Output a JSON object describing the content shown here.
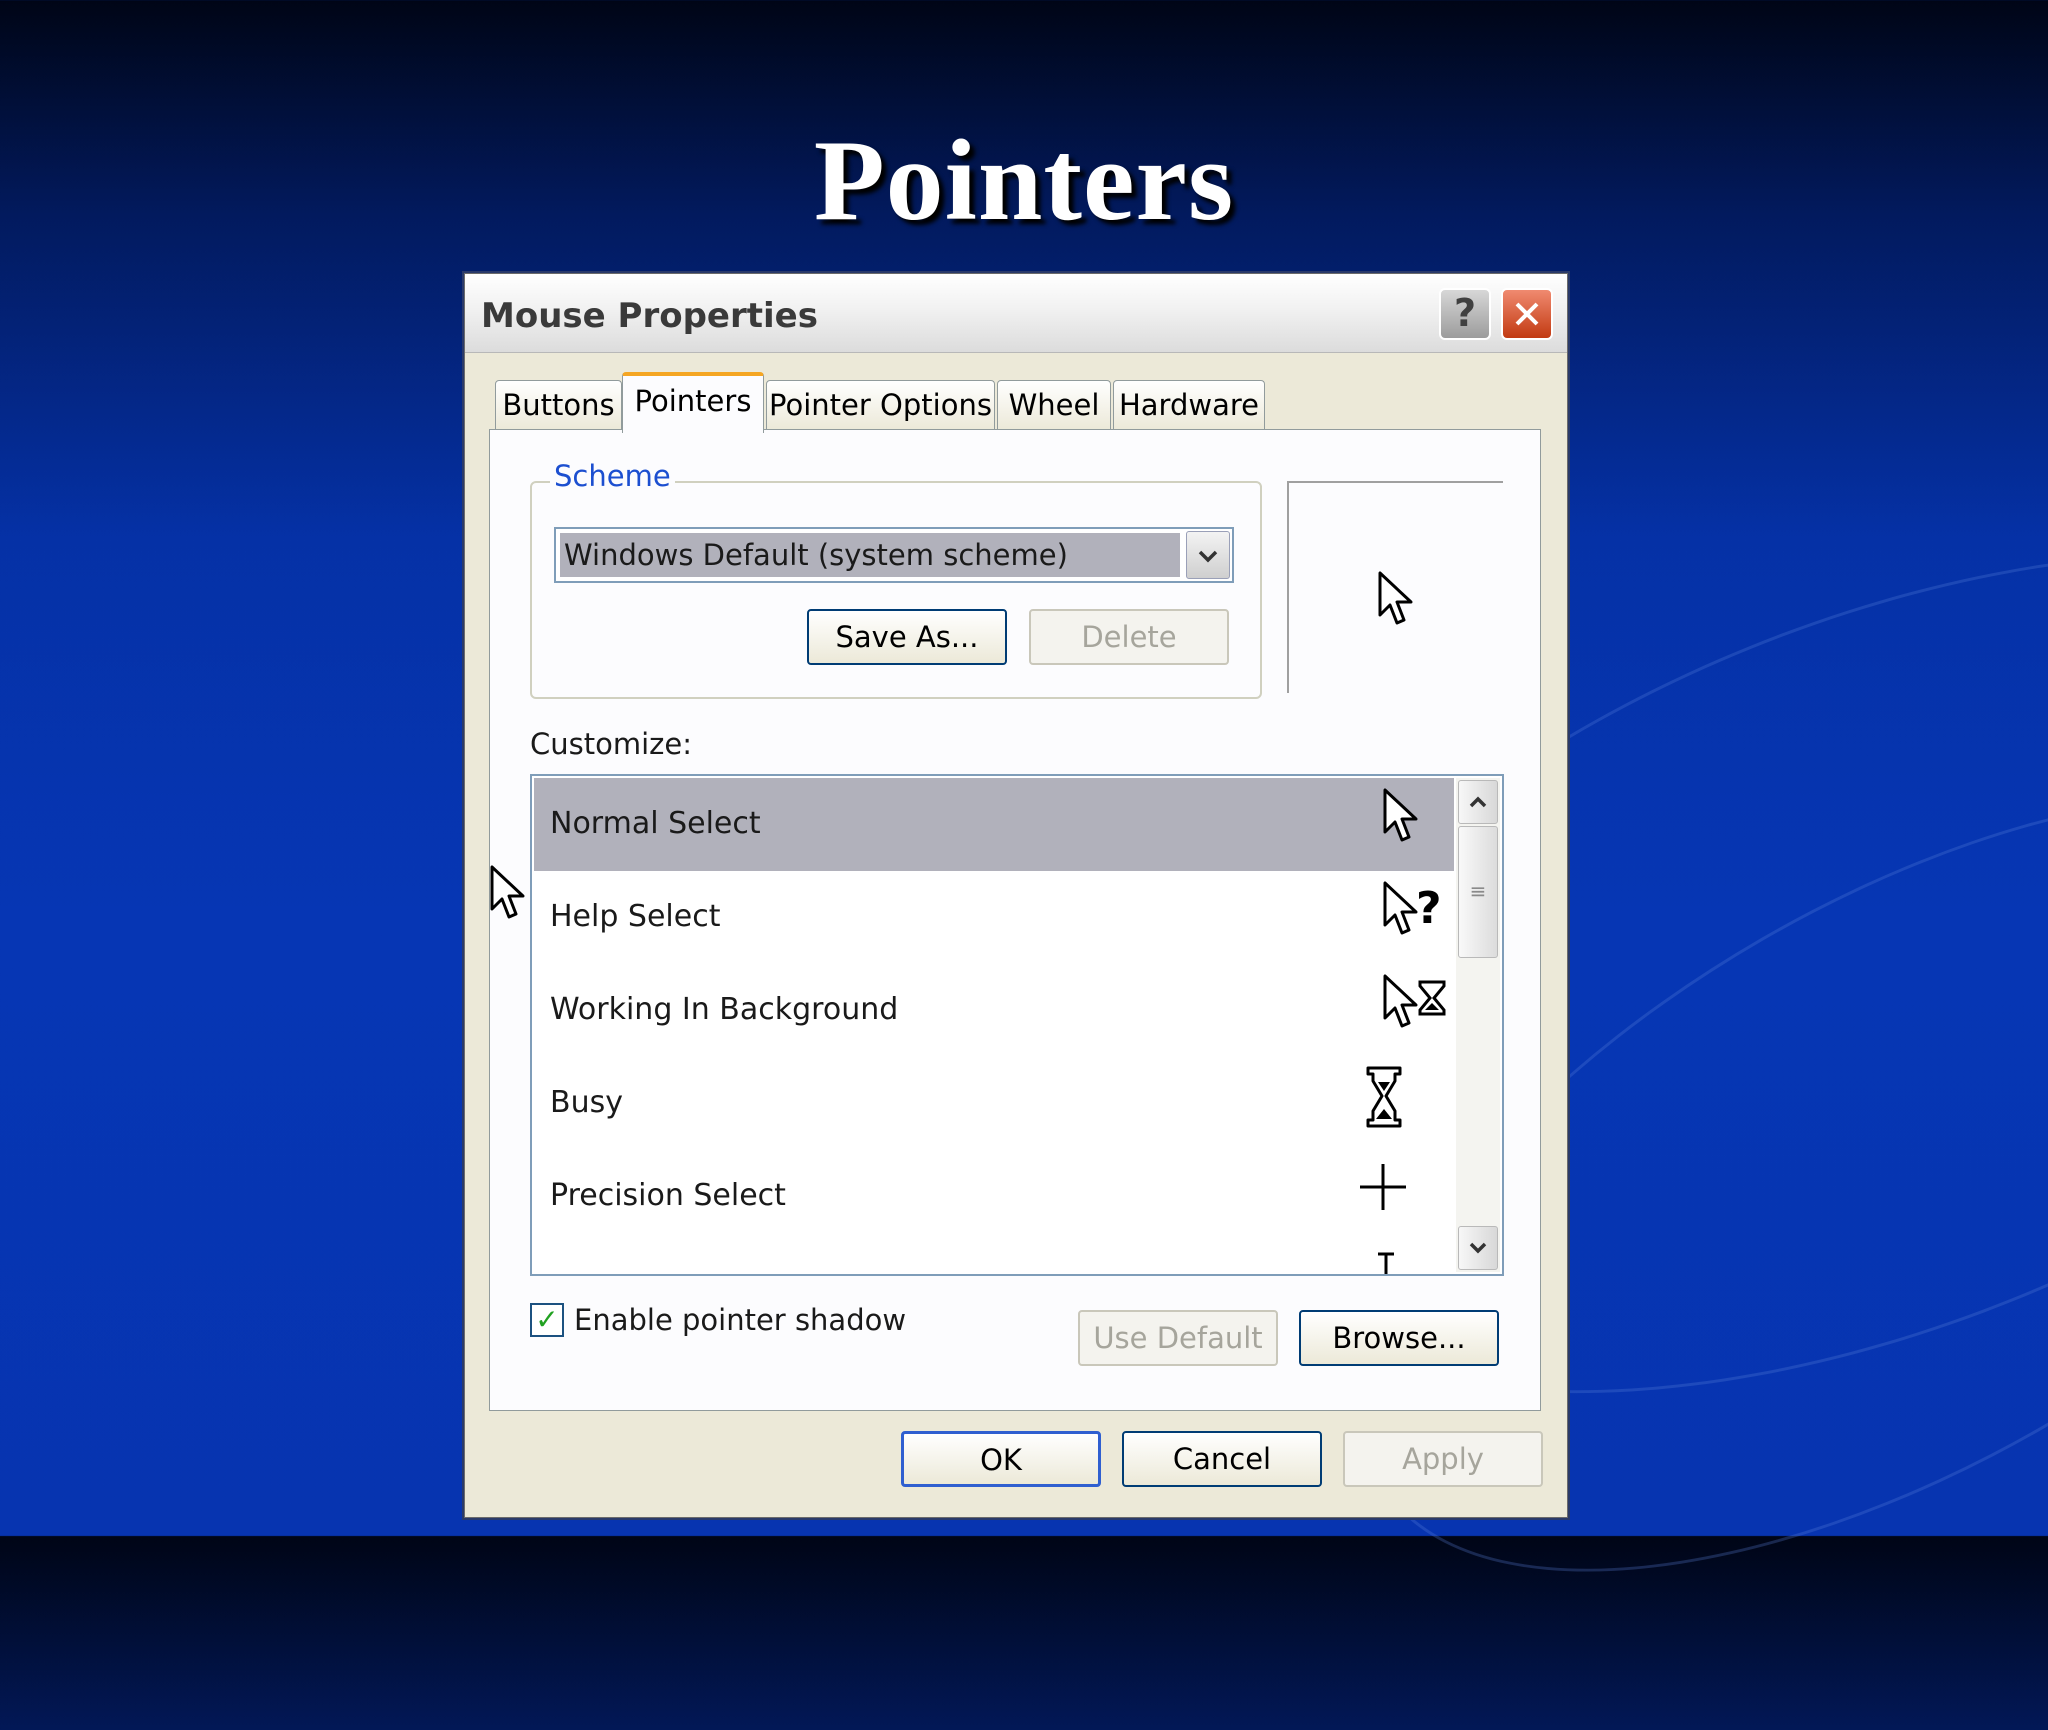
{
  "slide": {
    "title": "Pointers"
  },
  "window": {
    "title": "Mouse Properties",
    "help_label": "?",
    "close_label": "✕"
  },
  "tabs": [
    {
      "label": "Buttons",
      "active": false
    },
    {
      "label": "Pointers",
      "active": true
    },
    {
      "label": "Pointer Options",
      "active": false
    },
    {
      "label": "Wheel",
      "active": false
    },
    {
      "label": "Hardware",
      "active": false
    }
  ],
  "scheme": {
    "group_label": "Scheme",
    "selected": "Windows Default (system scheme)",
    "dropdown_icon": "chevron-down-icon",
    "save_as_label": "Save As...",
    "delete_label": "Delete"
  },
  "preview": {
    "icon": "arrow-cursor-icon"
  },
  "customize": {
    "label": "Customize:",
    "items": [
      {
        "label": "Normal Select",
        "icon": "arrow-cursor-icon",
        "selected": true
      },
      {
        "label": "Help Select",
        "icon": "help-cursor-icon",
        "selected": false
      },
      {
        "label": "Working In Background",
        "icon": "working-cursor-icon",
        "selected": false
      },
      {
        "label": "Busy",
        "icon": "hourglass-icon",
        "selected": false
      },
      {
        "label": "Precision Select",
        "icon": "crosshair-icon",
        "selected": false
      }
    ],
    "scroll_up_label": "▲",
    "scroll_down_label": "▼"
  },
  "options": {
    "shadow_label": "Enable pointer shadow",
    "shadow_checked": true,
    "check_mark": "✓",
    "use_default_label": "Use Default",
    "browse_label": "Browse..."
  },
  "footer": {
    "ok_label": "OK",
    "cancel_label": "Cancel",
    "apply_label": "Apply"
  },
  "colors": {
    "background": "#0636b4",
    "dialog_face": "#ece9d8",
    "selection": "#b1b1bb",
    "group_label": "#1c4fd0",
    "close_button": "#c23a12"
  }
}
